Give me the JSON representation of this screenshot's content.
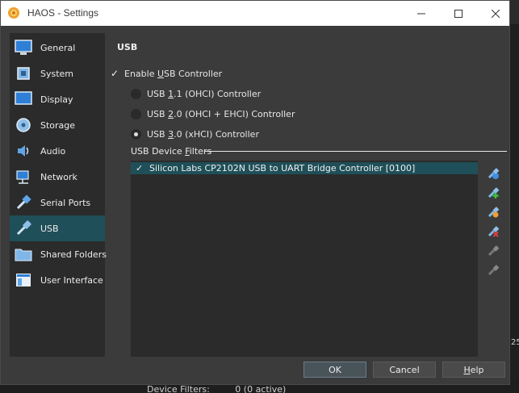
{
  "window": {
    "title": "HAOS - Settings"
  },
  "sidebar": {
    "items": [
      {
        "label": "General",
        "icon": "monitor-icon"
      },
      {
        "label": "System",
        "icon": "chip-icon"
      },
      {
        "label": "Display",
        "icon": "display-icon"
      },
      {
        "label": "Storage",
        "icon": "disk-icon"
      },
      {
        "label": "Audio",
        "icon": "speaker-icon"
      },
      {
        "label": "Network",
        "icon": "network-icon"
      },
      {
        "label": "Serial Ports",
        "icon": "serial-port-icon"
      },
      {
        "label": "USB",
        "icon": "usb-icon",
        "active": true
      },
      {
        "label": "Shared Folders",
        "icon": "folder-icon"
      },
      {
        "label": "User Interface",
        "icon": "ui-window-icon"
      }
    ]
  },
  "usb": {
    "section_title": "USB",
    "enable_controller": {
      "label_pre": "Enable ",
      "label_u": "U",
      "label_post": "SB Controller",
      "checked": true
    },
    "controllers": [
      {
        "pre": "USB ",
        "u": "1",
        "post": ".1 (OHCI) Controller",
        "selected": false
      },
      {
        "pre": "USB ",
        "u": "2",
        "post": ".0 (OHCI + EHCI) Controller",
        "selected": false
      },
      {
        "pre": "USB ",
        "u": "3",
        "post": ".0 (xHCI) Controller",
        "selected": true
      }
    ],
    "filters_label_pre": "USB Device ",
    "filters_label_u": "F",
    "filters_label_post": "ilters",
    "filters": [
      {
        "label": "Silicon Labs CP2102N USB to UART Bridge Controller [0100]",
        "checked": true
      }
    ],
    "tools": [
      "add-filter-icon",
      "add-from-device-icon",
      "edit-filter-icon",
      "remove-filter-icon",
      "move-up-icon",
      "move-down-icon"
    ]
  },
  "buttons": {
    "ok": "OK",
    "cancel": "Cancel",
    "help_u": "H",
    "help_post": "elp"
  },
  "background": {
    "device_filters": "Device Filters:",
    "device_filters_value": "0 (0 active)",
    "edge_num": "25"
  },
  "colors": {
    "selection": "#1f4f58",
    "window_bg": "#3b3b3b",
    "panel_bg": "#2b2b2b"
  }
}
